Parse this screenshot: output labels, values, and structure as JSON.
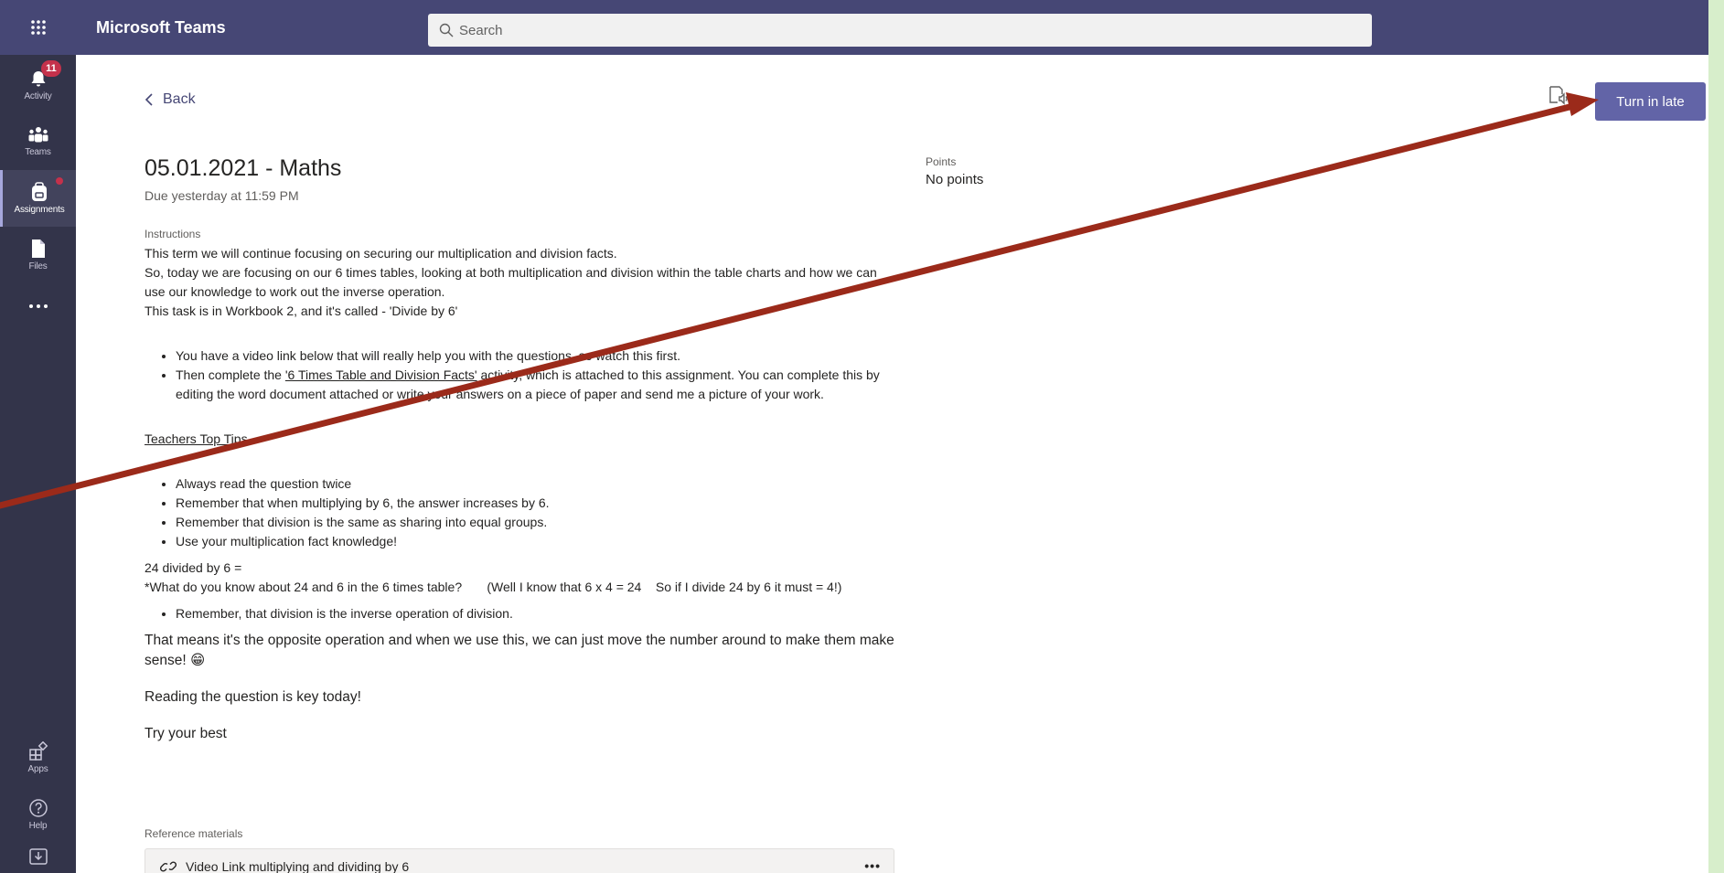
{
  "app": {
    "title": "Microsoft Teams"
  },
  "search": {
    "placeholder": "Search"
  },
  "rail": {
    "items": [
      {
        "label": "Activity",
        "icon": "bell-icon",
        "badge": "11"
      },
      {
        "label": "Teams",
        "icon": "teams-icon"
      },
      {
        "label": "Assignments",
        "icon": "backpack-icon",
        "active": true
      },
      {
        "label": "Files",
        "icon": "file-icon"
      },
      {
        "label": "",
        "icon": "more-icon"
      },
      {
        "label": "Apps",
        "icon": "apps-icon"
      },
      {
        "label": "Help",
        "icon": "help-icon"
      },
      {
        "label": "",
        "icon": "download-icon"
      }
    ]
  },
  "header": {
    "back_label": "Back",
    "turn_in_label": "Turn in late",
    "immersive_icon": "immersive-reader-icon"
  },
  "assignment": {
    "title": "05.01.2021 - Maths",
    "due": "Due yesterday at 11:59 PM",
    "points_label": "Points",
    "points_value": "No points",
    "instructions_label": "Instructions",
    "intro": [
      "This term we will continue focusing on securing our multiplication and division facts.",
      "So, today we are focusing on our 6 times tables, looking at both multiplication and division within the table charts and how we can use our knowledge to work out the inverse operation.",
      "This task is in Workbook 2, and it's called - 'Divide by 6'"
    ],
    "steps": {
      "first": "You have a video link below that will really help you with the questions, so watch this first.",
      "second_pre": "Then complete the ",
      "second_link": "'6 Times Table and Division Facts'",
      "second_post": " activity, which is attached to this assignment. You can complete this by editing the word document attached or write your answers on a piece of paper and send me a picture of your work."
    },
    "tips_heading": "Teachers Top Tips",
    "tips": [
      "Always read the question twice",
      "Remember that when multiplying by 6, the answer increases by 6.",
      "Remember that division is the same as sharing into equal groups.",
      "Use your multiplication fact knowledge!"
    ],
    "example_line1": "24 divided by 6 =",
    "example_line2": "*What do you know about 24 and 6 in the 6 times table?       (Well I know that 6 x 4 = 24    So if I divide 24 by 6 it must = 4!)",
    "inverse_bullet": "Remember, that division is the inverse operation of division.",
    "opposite_text": "That means it's the opposite operation and when we use this, we can just move the number around to make them make sense! 😁",
    "reading_key": "Reading the question is key today!",
    "try_best": "Try your best",
    "reference_label": "Reference materials",
    "reference_item": "Video Link multiplying and dividing by 6",
    "reference_more": "•••"
  },
  "colors": {
    "rail": "#33344a",
    "topbar": "#464775",
    "accent": "#6264a7",
    "arrow": "#9b2a1a",
    "badge": "#c4314b"
  }
}
